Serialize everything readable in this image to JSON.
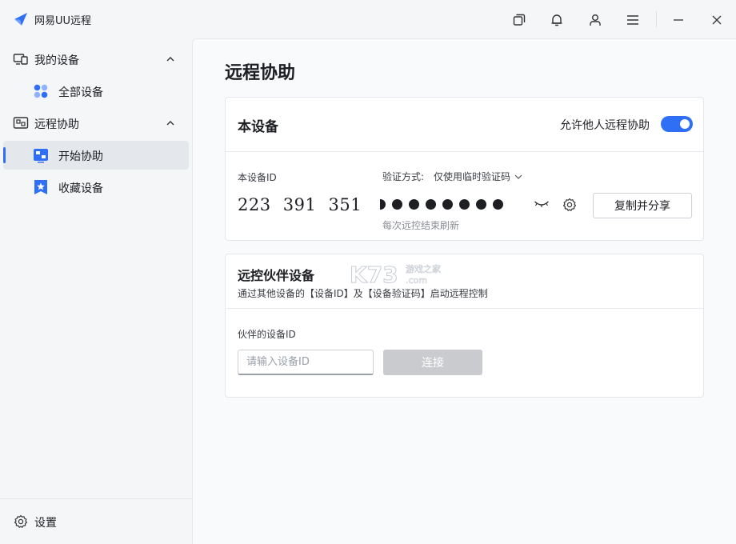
{
  "app": {
    "title": "网易UU远程"
  },
  "sidebar": {
    "groups": [
      {
        "label": "我的设备",
        "items": [
          {
            "label": "全部设备"
          }
        ]
      },
      {
        "label": "远程协助",
        "items": [
          {
            "label": "开始协助"
          },
          {
            "label": "收藏设备"
          }
        ]
      }
    ],
    "settings_label": "设置"
  },
  "main": {
    "page_title": "远程协助",
    "this_device": {
      "title": "本设备",
      "allow_label": "允许他人远程协助",
      "allow_enabled": true,
      "device_id_label": "本设备ID",
      "device_id": "223 391 351",
      "verify_label": "验证方式:",
      "verify_value": "仅使用临时验证码",
      "password_masked": "●●●●●●●●",
      "refresh_hint": "每次远控结束刷新",
      "copy_button": "复制并分享"
    },
    "partner": {
      "title": "远控伙伴设备",
      "subtitle": "通过其他设备的【设备ID】及【设备验证码】启动远程控制",
      "id_label": "伙伴的设备ID",
      "id_placeholder": "请输入设备ID",
      "id_value": "",
      "connect_button": "连接"
    }
  },
  "watermark": {
    "text": "K73",
    "sub1": "游戏之家",
    "sub2": ".com"
  },
  "colors": {
    "accent": "#2f6ff5",
    "disabled": "#c9cbcf"
  }
}
